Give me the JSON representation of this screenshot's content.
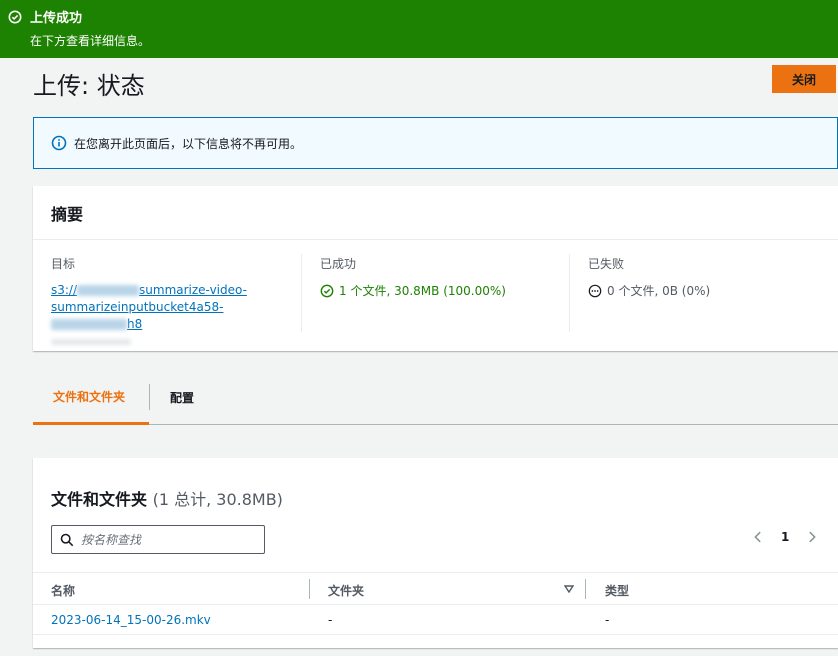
{
  "flash": {
    "title": "上传成功",
    "description": "在下方查看详细信息。",
    "color": "#1d8102"
  },
  "page": {
    "title": "上传: 状态",
    "close_label": "关闭"
  },
  "info_alert": {
    "text": "在您离开此页面后，以下信息将不再可用。"
  },
  "summary": {
    "heading": "摘要",
    "destination": {
      "label": "目标",
      "link_part1": "s3://",
      "link_part2": "summarize-video-",
      "link_part3": "summarizeinputbucket4a58-",
      "link_part4": "h8"
    },
    "succeeded": {
      "label": "已成功",
      "value": "1 个文件, 30.8MB (100.00%)"
    },
    "failed": {
      "label": "已失败",
      "value": "0 个文件, 0B (0%)"
    }
  },
  "tabs": [
    {
      "label": "文件和文件夹",
      "active": true
    },
    {
      "label": "配置",
      "active": false
    }
  ],
  "files": {
    "title": "文件和文件夹",
    "count": "(1 总计, 30.8MB)",
    "search_placeholder": "按名称查找",
    "current_page": "1",
    "columns": [
      "名称",
      "文件夹",
      "类型"
    ],
    "rows": [
      {
        "name": "2023-06-14_15-00-26.mkv",
        "folder": "-",
        "type": "-"
      }
    ]
  }
}
